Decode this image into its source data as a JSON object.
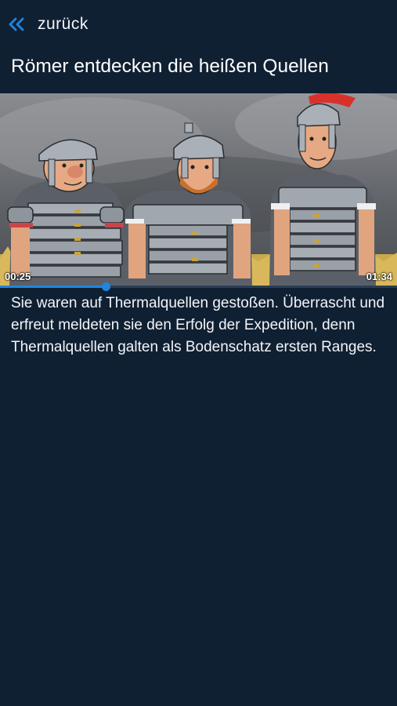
{
  "nav": {
    "back_label": "zurück",
    "back_icon": "double-chevron-left-icon",
    "accent_color": "#1f86e0"
  },
  "page": {
    "title": "Römer entdecken die heißen Quellen",
    "background_color": "#102033"
  },
  "video": {
    "thumbnail": "Illustration: drei römische Legionäre in Rüstung",
    "current_time": "00:25",
    "duration": "01:34",
    "progress_fraction": 0.266
  },
  "description": "Sie waren auf Thermalquellen gestoßen. Überrascht und erfreut meldeten sie den Erfolg der Expedition, denn Thermalquellen galten als Bodenschatz ersten Ranges."
}
